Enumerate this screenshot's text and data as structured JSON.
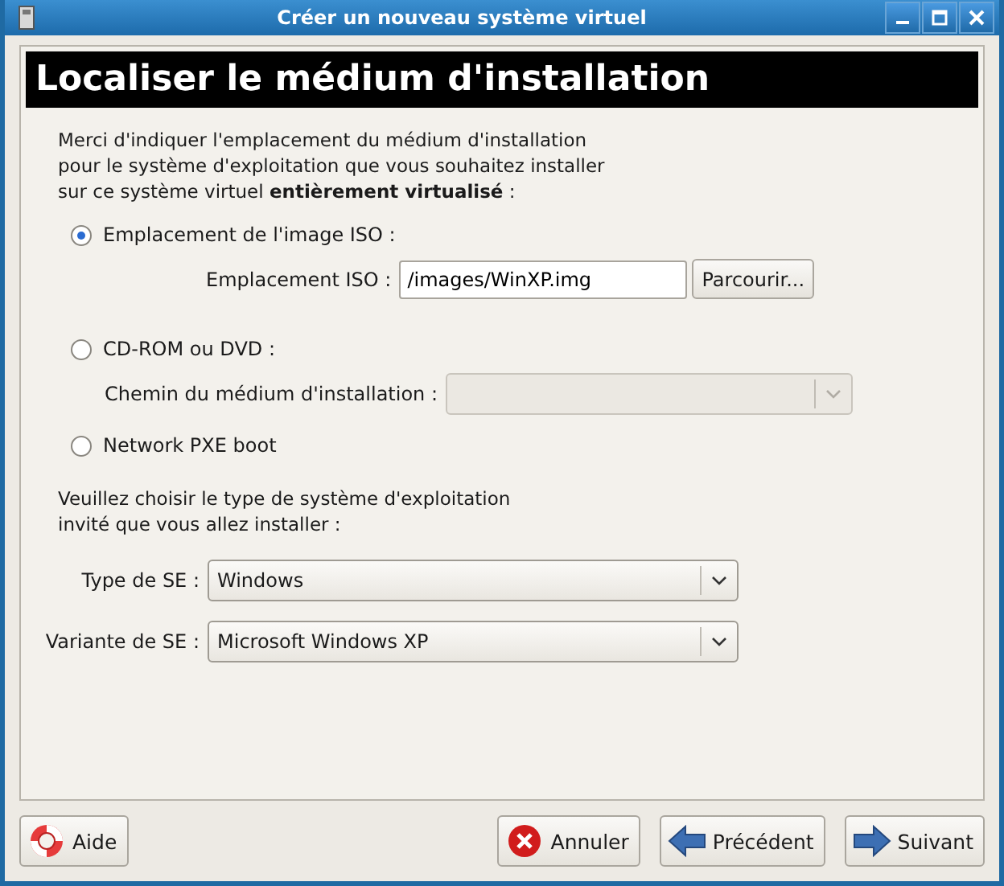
{
  "window": {
    "title": "Créer un nouveau système virtuel"
  },
  "header": "Localiser le médium d'installation",
  "intro": "Merci d'indiquer l'emplacement du médium d'installation pour le système d'exploitation que vous souhaitez installer sur ce système virtuel **entièrement virtualisé** :",
  "media_options": [
    {
      "kind": "iso",
      "label": "Emplacement de l'image ISO :",
      "selected": true,
      "field_label": "Emplacement ISO :",
      "value": "/images/WinXP.img",
      "button": "Parcourir..."
    },
    {
      "kind": "path",
      "label": "CD-ROM ou DVD :",
      "selected": false,
      "field_label": "Chemin du médium d'installation :",
      "disabled": true
    },
    {
      "kind": "plain",
      "label": "Network PXE boot",
      "selected": false
    }
  ],
  "os_prompt": "Veuillez choisir le type de système d'exploitation invité que vous allez installer :",
  "os_fields": [
    {
      "label": "Type de SE :",
      "value": "Windows"
    },
    {
      "label": "Variante de SE :",
      "value": "Microsoft Windows XP"
    }
  ],
  "buttons": [
    {
      "kind": "help",
      "label": "Aide"
    },
    {
      "kind": "cancel",
      "label": "Annuler"
    },
    {
      "kind": "back",
      "label": "Précédent"
    },
    {
      "kind": "forward",
      "label": "Suivant"
    }
  ]
}
